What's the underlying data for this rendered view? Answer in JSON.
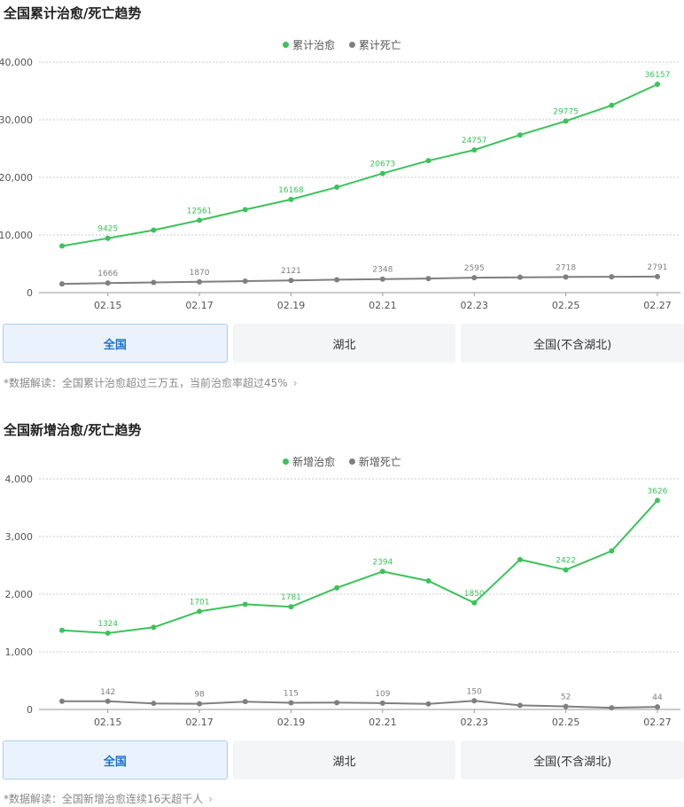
{
  "sections": [
    {
      "title": "全国累计治愈/死亡趋势",
      "tabs": [
        "全国",
        "湖北",
        "全国(不含湖北)"
      ],
      "active_tab": 0,
      "note": "*数据解读：全国累计治愈超过三万五，当前治愈率超过45%",
      "colors": {
        "cured": "#3bc35a",
        "dead": "#7f7f7f"
      }
    },
    {
      "title": "全国新增治愈/死亡趋势",
      "tabs": [
        "全国",
        "湖北",
        "全国(不含湖北)"
      ],
      "active_tab": 0,
      "note": "*数据解读：全国新增治愈连续16天超千人",
      "colors": {
        "cured": "#3bc35a",
        "dead": "#7f7f7f"
      }
    }
  ],
  "chart_data": [
    {
      "type": "line",
      "categories": [
        "",
        "02.15",
        "",
        "02.17",
        "",
        "02.19",
        "",
        "02.21",
        "",
        "02.23",
        "",
        "02.25",
        "",
        "02.27"
      ],
      "ylim": [
        0,
        40000
      ],
      "yticks": [
        0,
        10000,
        20000,
        30000,
        40000
      ],
      "ytick_labels": [
        "0",
        "10,000",
        "20,000",
        "30,000",
        "40,000"
      ],
      "grid": true,
      "legend_position": "top-center",
      "series": [
        {
          "name": "累计治愈",
          "values": [
            8100,
            9425,
            10850,
            12561,
            14400,
            16168,
            18300,
            20673,
            22900,
            24757,
            27350,
            29775,
            32500,
            36157
          ],
          "labels": [
            "",
            "9425",
            "",
            "12561",
            "",
            "16168",
            "",
            "20673",
            "",
            "24757",
            "",
            "29775",
            "",
            "36157"
          ]
        },
        {
          "name": "累计死亡",
          "values": [
            1524,
            1666,
            1770,
            1870,
            2004,
            2121,
            2239,
            2348,
            2445,
            2595,
            2666,
            2718,
            2747,
            2791
          ],
          "labels": [
            "",
            "1666",
            "",
            "1870",
            "",
            "2121",
            "",
            "2348",
            "",
            "2595",
            "",
            "2718",
            "",
            "2791"
          ]
        }
      ]
    },
    {
      "type": "line",
      "categories": [
        "",
        "02.15",
        "",
        "02.17",
        "",
        "02.19",
        "",
        "02.21",
        "",
        "02.23",
        "",
        "02.25",
        "",
        "02.27"
      ],
      "ylim": [
        0,
        4000
      ],
      "yticks": [
        0,
        1000,
        2000,
        3000,
        4000
      ],
      "ytick_labels": [
        "0",
        "1,000",
        "2,000",
        "3,000",
        "4,000"
      ],
      "grid": true,
      "legend_position": "top-center",
      "series": [
        {
          "name": "新增治愈",
          "values": [
            1373,
            1324,
            1425,
            1701,
            1824,
            1781,
            2109,
            2394,
            2231,
            1850,
            2600,
            2422,
            2750,
            3626
          ],
          "labels": [
            "",
            "1324",
            "",
            "1701",
            "",
            "1781",
            "",
            "2394",
            "",
            "1850",
            "",
            "2422",
            "",
            "3626"
          ]
        },
        {
          "name": "新增死亡",
          "values": [
            143,
            142,
            105,
            98,
            136,
            115,
            118,
            109,
            97,
            150,
            71,
            52,
            29,
            44
          ],
          "labels": [
            "",
            "142",
            "",
            "98",
            "",
            "115",
            "",
            "109",
            "",
            "150",
            "",
            "52",
            "",
            "44"
          ]
        }
      ]
    }
  ]
}
